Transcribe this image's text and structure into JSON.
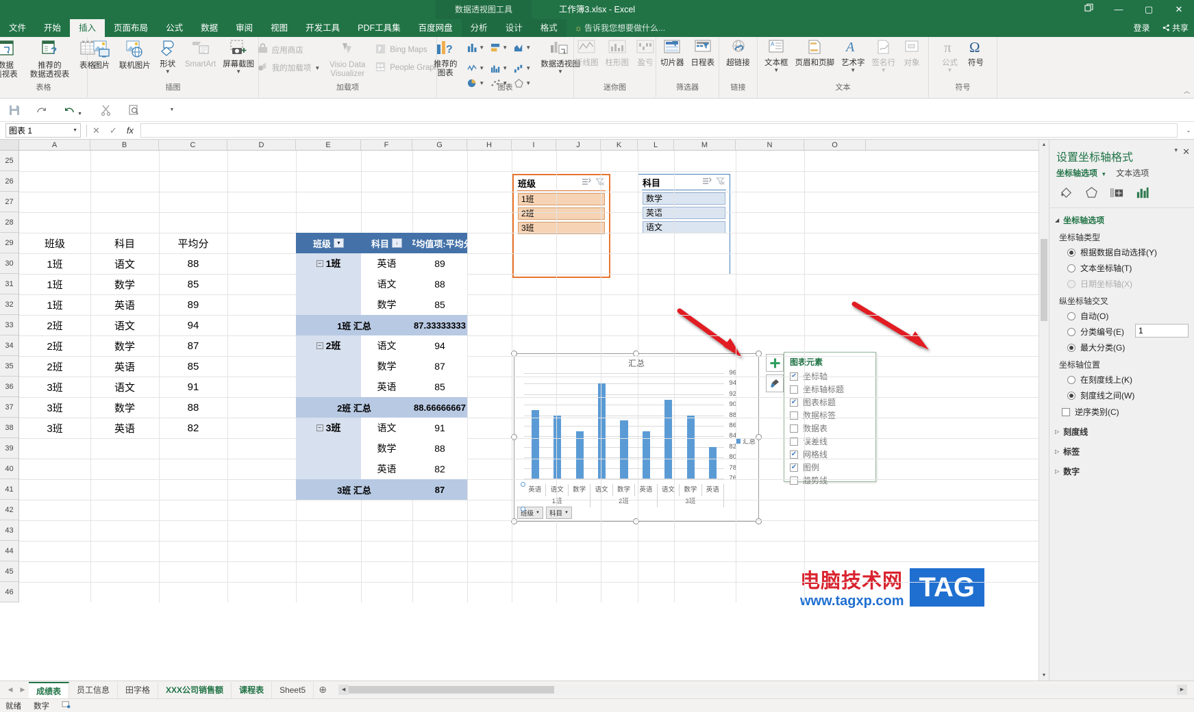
{
  "titlebar": {
    "app_title": "工作簿3.xlsx - Excel",
    "context_tools": "数据透视图工具",
    "restore_icon": "restore-icon",
    "minimize": "—",
    "maximize": "▢",
    "close": "✕"
  },
  "tabs": [
    {
      "label": "文件",
      "active": false
    },
    {
      "label": "开始",
      "active": false
    },
    {
      "label": "插入",
      "active": true
    },
    {
      "label": "页面布局",
      "active": false
    },
    {
      "label": "公式",
      "active": false
    },
    {
      "label": "数据",
      "active": false
    },
    {
      "label": "审阅",
      "active": false
    },
    {
      "label": "视图",
      "active": false
    },
    {
      "label": "开发工具",
      "active": false
    },
    {
      "label": "PDF工具集",
      "active": false
    },
    {
      "label": "百度网盘",
      "active": false
    }
  ],
  "ctx_tabs": [
    {
      "label": "分析"
    },
    {
      "label": "设计"
    },
    {
      "label": "格式"
    }
  ],
  "tellme": "告诉我您想要做什么...",
  "account": {
    "signin": "登录",
    "share": "共享",
    "share_icon": "share-icon"
  },
  "ribbon": {
    "groups": [
      {
        "name": "表格",
        "items": [
          {
            "label": "数据\n透视表",
            "icon": "pivot-table-icon",
            "caret": true,
            "disabled": false
          },
          {
            "label": "推荐的\n数据透视表",
            "icon": "recommended-pivot-icon",
            "caret": false,
            "disabled": false
          },
          {
            "label": "表格",
            "icon": "table-icon",
            "caret": false,
            "disabled": false
          }
        ]
      },
      {
        "name": "插图",
        "items": [
          {
            "label": "图片",
            "icon": "picture-icon",
            "caret": false,
            "disabled": false
          },
          {
            "label": "联机图片",
            "icon": "online-picture-icon",
            "caret": false,
            "disabled": false
          },
          {
            "label": "形状",
            "icon": "shapes-icon",
            "caret": true,
            "disabled": false
          },
          {
            "label": "SmartArt",
            "icon": "smartart-icon",
            "caret": false,
            "disabled": true
          },
          {
            "label": "屏幕截图",
            "icon": "screenshot-icon",
            "caret": true,
            "disabled": false
          }
        ]
      },
      {
        "name": "加载项",
        "items": [
          {
            "label": "应用商店",
            "icon": "store-icon",
            "disabled": true
          },
          {
            "label": "我的加载项",
            "icon": "addins-icon",
            "caret": true,
            "disabled": true
          },
          {
            "label": "Visio Data Visualizer",
            "icon": "visio-icon",
            "disabled": true
          },
          {
            "label": "Bing Maps",
            "icon": "bing-maps-icon",
            "disabled": true
          },
          {
            "label": "People Graph",
            "icon": "people-graph-icon",
            "disabled": true
          }
        ]
      },
      {
        "name": "图表",
        "items": [
          {
            "label": "推荐的\n图表",
            "icon": "recommended-charts-icon",
            "disabled": false
          },
          {
            "label": "数据透视图",
            "icon": "pivot-chart-icon",
            "caret": true,
            "disabled": false
          }
        ]
      },
      {
        "name": "迷你图",
        "items": [
          {
            "label": "折线图",
            "icon": "sparkline-line-icon",
            "disabled": true
          },
          {
            "label": "柱形图",
            "icon": "sparkline-column-icon",
            "disabled": true
          },
          {
            "label": "盈亏",
            "icon": "sparkline-winloss-icon",
            "disabled": true
          }
        ]
      },
      {
        "name": "筛选器",
        "items": [
          {
            "label": "切片器",
            "icon": "slicer-icon",
            "disabled": false
          },
          {
            "label": "日程表",
            "icon": "timeline-icon",
            "disabled": false
          }
        ]
      },
      {
        "name": "链接",
        "items": [
          {
            "label": "超链接",
            "icon": "hyperlink-icon",
            "disabled": false
          }
        ]
      },
      {
        "name": "文本",
        "items": [
          {
            "label": "文本框",
            "icon": "textbox-icon",
            "caret": true,
            "disabled": false
          },
          {
            "label": "页眉和页脚",
            "icon": "header-footer-icon",
            "disabled": false
          },
          {
            "label": "艺术字",
            "icon": "wordart-icon",
            "caret": true,
            "disabled": false
          },
          {
            "label": "签名行",
            "icon": "signature-line-icon",
            "caret": true,
            "disabled": true
          },
          {
            "label": "对象",
            "icon": "object-icon",
            "disabled": true
          }
        ]
      },
      {
        "name": "符号",
        "items": [
          {
            "label": "公式",
            "icon": "equation-icon",
            "caret": true,
            "disabled": true
          },
          {
            "label": "符号",
            "icon": "symbol-icon",
            "disabled": false
          }
        ]
      }
    ]
  },
  "quick_access": [
    "save-icon",
    "redo-icon",
    "undo-icon",
    "cut-icon",
    "print-preview-icon"
  ],
  "formula_bar": {
    "name_box": "图表 1",
    "cancel_icon": "✕",
    "confirm_icon": "✓",
    "fx_icon": "fx",
    "value": "",
    "expand_icon": "⌄"
  },
  "grid": {
    "columns": [
      "A",
      "B",
      "C",
      "D",
      "E",
      "F",
      "G",
      "H",
      "I",
      "J",
      "K",
      "L",
      "M",
      "N",
      "O"
    ],
    "rows": [
      "25",
      "26",
      "27",
      "28",
      "29",
      "30",
      "31",
      "32",
      "33",
      "34",
      "35",
      "36",
      "37",
      "38",
      "39",
      "40",
      "41",
      "42",
      "43",
      "44",
      "45",
      "46"
    ],
    "source_table": {
      "headers": [
        "班级",
        "科目",
        "平均分"
      ],
      "rows": [
        [
          "1班",
          "语文",
          "88"
        ],
        [
          "1班",
          "数学",
          "85"
        ],
        [
          "1班",
          "英语",
          "89"
        ],
        [
          "2班",
          "语文",
          "94"
        ],
        [
          "2班",
          "数学",
          "87"
        ],
        [
          "2班",
          "英语",
          "85"
        ],
        [
          "3班",
          "语文",
          "91"
        ],
        [
          "3班",
          "数学",
          "88"
        ],
        [
          "3班",
          "英语",
          "82"
        ]
      ]
    },
    "pivot_table": {
      "headers": [
        "班级",
        "科目",
        "平均值项:平均分"
      ],
      "rows": [
        {
          "type": "group",
          "group": "1班",
          "subject": "英语",
          "value": "89"
        },
        {
          "type": "item",
          "group": "",
          "subject": "语文",
          "value": "88"
        },
        {
          "type": "item",
          "group": "",
          "subject": "数学",
          "value": "85"
        },
        {
          "type": "total",
          "group": "1班 汇总",
          "subject": "",
          "value": "87.33333333"
        },
        {
          "type": "group",
          "group": "2班",
          "subject": "语文",
          "value": "94"
        },
        {
          "type": "item",
          "group": "",
          "subject": "数学",
          "value": "87"
        },
        {
          "type": "item",
          "group": "",
          "subject": "英语",
          "value": "85"
        },
        {
          "type": "total",
          "group": "2班 汇总",
          "subject": "",
          "value": "88.66666667"
        },
        {
          "type": "group",
          "group": "3班",
          "subject": "语文",
          "value": "91"
        },
        {
          "type": "item",
          "group": "",
          "subject": "数学",
          "value": "88"
        },
        {
          "type": "item",
          "group": "",
          "subject": "英语",
          "value": "82"
        },
        {
          "type": "total",
          "group": "3班 汇总",
          "subject": "",
          "value": "87"
        }
      ]
    }
  },
  "slicers": [
    {
      "title": "班级",
      "accent": "#e8742c",
      "item_bg": "#f6d3b4",
      "item_border": "#d69a6a",
      "items": [
        "1班",
        "2班",
        "3班"
      ],
      "multiselect_icon": "multiselect-icon",
      "clearfilter_icon": "clear-filter-icon"
    },
    {
      "title": "科目",
      "accent": "#4a7ebb",
      "item_bg": "#dbe5f1",
      "item_border": "#9cb4d4",
      "items": [
        "数学",
        "英语",
        "语文"
      ],
      "multiselect_icon": "multiselect-icon",
      "clearfilter_icon": "clear-filter-icon"
    }
  ],
  "chart_data": {
    "type": "bar",
    "title": "汇总",
    "series": [
      {
        "name": "汇总",
        "values": [
          89,
          88,
          85,
          94,
          87,
          85,
          91,
          88,
          82
        ]
      }
    ],
    "categories": [
      "英语",
      "语文",
      "数学",
      "语文",
      "数学",
      "英语",
      "语文",
      "数学",
      "英语"
    ],
    "group_labels": [
      "1班",
      "2班",
      "3班"
    ],
    "groups_of": 3,
    "ylim": [
      76,
      96
    ],
    "yticks": [
      96,
      94,
      92,
      90,
      88,
      86,
      84,
      82,
      80,
      78,
      76
    ],
    "ytick_labels": [
      "96",
      "94",
      "92",
      "90",
      "88",
      "86",
      "84",
      "82",
      "80",
      "78",
      "76"
    ],
    "legend": [
      "汇总"
    ],
    "legend_position": "right",
    "grid": true,
    "bar_color": "#5b9bd5",
    "xlabel": "",
    "ylabel": "",
    "field_buttons": [
      "班级",
      "科目"
    ]
  },
  "chart_elements_flyout": {
    "title": "图表元素",
    "items": [
      {
        "label": "坐标轴",
        "checked": true
      },
      {
        "label": "坐标轴标题",
        "checked": false
      },
      {
        "label": "图表标题",
        "checked": true
      },
      {
        "label": "数据标签",
        "checked": false
      },
      {
        "label": "数据表",
        "checked": false
      },
      {
        "label": "误差线",
        "checked": false
      },
      {
        "label": "网格线",
        "checked": true
      },
      {
        "label": "图例",
        "checked": true
      },
      {
        "label": "趋势线",
        "checked": false
      }
    ]
  },
  "chart_side_buttons": [
    {
      "name": "chart-elements-plus-button",
      "glyph": "＋"
    },
    {
      "name": "chart-styles-brush-button",
      "glyph": "brush-icon"
    }
  ],
  "task_pane": {
    "title": "设置坐标轴格式",
    "minimize_icon": "▾",
    "close_icon": "✕",
    "subtabs": [
      {
        "label": "坐标轴选项",
        "active": true,
        "caret": "▼"
      },
      {
        "label": "文本选项",
        "active": false
      }
    ],
    "icon_tabs": [
      "fill-icon",
      "effects-icon",
      "size-properties-icon",
      "axis-options-icon"
    ],
    "sections": [
      {
        "header": "坐标轴选项",
        "expanded": true,
        "sub_label_1": "坐标轴类型",
        "axis_type_options": [
          {
            "label": "根据数据自动选择(Y)",
            "selected": true,
            "disabled": false
          },
          {
            "label": "文本坐标轴(T)",
            "selected": false,
            "disabled": false
          },
          {
            "label": "日期坐标轴(X)",
            "selected": false,
            "disabled": true
          }
        ],
        "sub_label_2": "纵坐标轴交叉",
        "cross_options": [
          {
            "label": "自动(O)",
            "selected": false,
            "disabled": false,
            "field": null
          },
          {
            "label": "分类编号(E)",
            "selected": false,
            "disabled": false,
            "field": "1"
          },
          {
            "label": "最大分类(G)",
            "selected": true,
            "disabled": false,
            "field": null
          }
        ],
        "sub_label_3": "坐标轴位置",
        "position_options": [
          {
            "label": "在刻度线上(K)",
            "selected": false
          },
          {
            "label": "刻度线之间(W)",
            "selected": true
          }
        ],
        "checkbox": {
          "label": "逆序类别(C)",
          "checked": false
        }
      },
      {
        "header": "刻度线",
        "expanded": false
      },
      {
        "header": "标签",
        "expanded": false
      },
      {
        "header": "数字",
        "expanded": false
      }
    ]
  },
  "sheet_tabs": [
    {
      "label": "成绩表",
      "active": true
    },
    {
      "label": "员工信息",
      "active": false
    },
    {
      "label": "田字格",
      "active": false
    },
    {
      "label": "XXX公司销售额",
      "active": false,
      "highlight": true
    },
    {
      "label": "课程表",
      "active": false,
      "highlight": true
    },
    {
      "label": "Sheet5",
      "active": false
    }
  ],
  "add_sheet_icon": "⊕",
  "status_bar": {
    "left": "就绪",
    "mode": "数字",
    "icons": [
      "record-macro-icon"
    ]
  },
  "watermark": {
    "text": "电脑技术网",
    "tag": "TAG",
    "url": "www.tagxp.com"
  }
}
